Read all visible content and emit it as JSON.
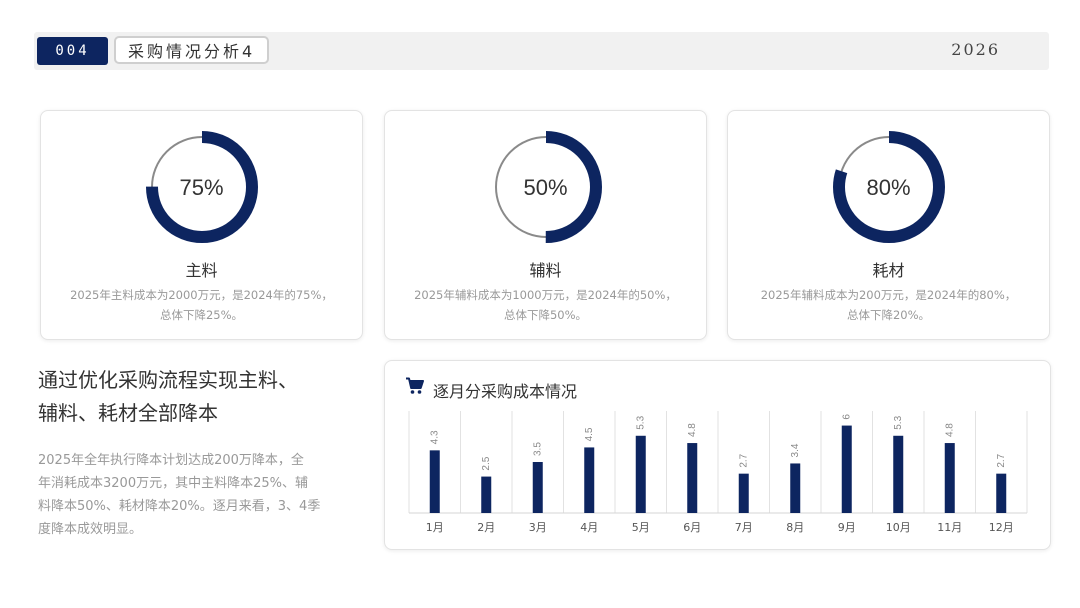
{
  "header": {
    "slide_number": "004",
    "title": "采购情况分析4",
    "year": "2026"
  },
  "colors": {
    "accent": "#0d2560",
    "ring_track": "#8a8a8a",
    "muted_text": "#999999"
  },
  "cards": [
    {
      "percent": 75,
      "percent_label": "75%",
      "title": "主料",
      "desc_line1": "2025年主料成本为2000万元，是2024年的75%，",
      "desc_line2": "总体下降25%。"
    },
    {
      "percent": 50,
      "percent_label": "50%",
      "title": "辅料",
      "desc_line1": "2025年辅料成本为1000万元，是2024年的50%，",
      "desc_line2": "总体下降50%。"
    },
    {
      "percent": 80,
      "percent_label": "80%",
      "title": "耗材",
      "desc_line1": "2025年辅料成本为200万元，是2024年的80%，",
      "desc_line2": "总体下降20%。"
    }
  ],
  "summary": {
    "title_line1": "通过优化采购流程实现主料、",
    "title_line2": "辅料、耗材全部降本",
    "text_lines": [
      "2025年全年执行降本计划达成200万降本，全",
      "年消耗成本3200万元，其中主料降本25%、辅",
      "料降本50%、耗材降本20%。逐月来看，3、4季",
      "度降本成效明显。"
    ]
  },
  "chart_data": {
    "type": "bar",
    "title": "逐月分采购成本情况",
    "icon": "shopping-cart-icon",
    "categories": [
      "1月",
      "2月",
      "3月",
      "4月",
      "5月",
      "6月",
      "7月",
      "8月",
      "9月",
      "10月",
      "11月",
      "12月"
    ],
    "values": [
      4.3,
      2.5,
      3.5,
      4.5,
      5.3,
      4.8,
      2.7,
      3.4,
      6,
      5.3,
      4.8,
      2.7
    ],
    "value_labels": [
      "4.3",
      "2.5",
      "3.5",
      "4.5",
      "5.3",
      "4.8",
      "2.7",
      "3.4",
      "6",
      "5.3",
      "4.8",
      "2.7"
    ],
    "ylim": [
      0,
      7
    ],
    "grid": "vertical"
  }
}
